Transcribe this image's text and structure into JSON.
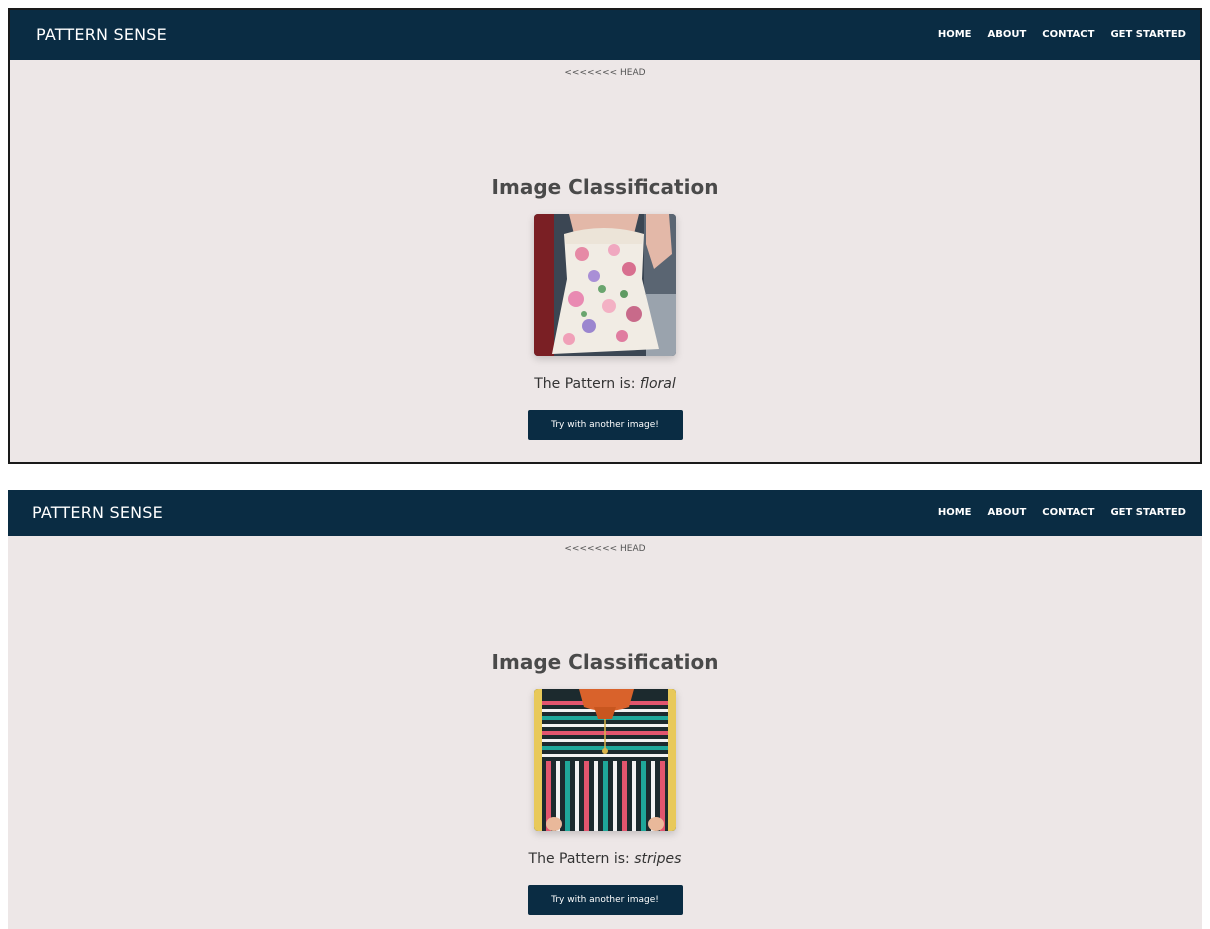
{
  "screens": [
    {
      "brand": "PATTERN SENSE",
      "nav": [
        "HOME",
        "ABOUT",
        "CONTACT",
        "GET STARTED"
      ],
      "head_marker": "<<<<<<< HEAD",
      "title": "Image Classification",
      "result_prefix": "The Pattern is:",
      "result_value": "floral",
      "button_label": "Try with another image!"
    },
    {
      "brand": "PATTERN SENSE",
      "nav": [
        "HOME",
        "ABOUT",
        "CONTACT",
        "GET STARTED"
      ],
      "head_marker": "<<<<<<< HEAD",
      "title": "Image Classification",
      "result_prefix": "The Pattern is:",
      "result_value": "stripes",
      "button_label": "Try with another image!"
    }
  ],
  "colors": {
    "navbar": "#0a2c43",
    "background": "#ede7e7",
    "title": "#4a4a4a"
  }
}
